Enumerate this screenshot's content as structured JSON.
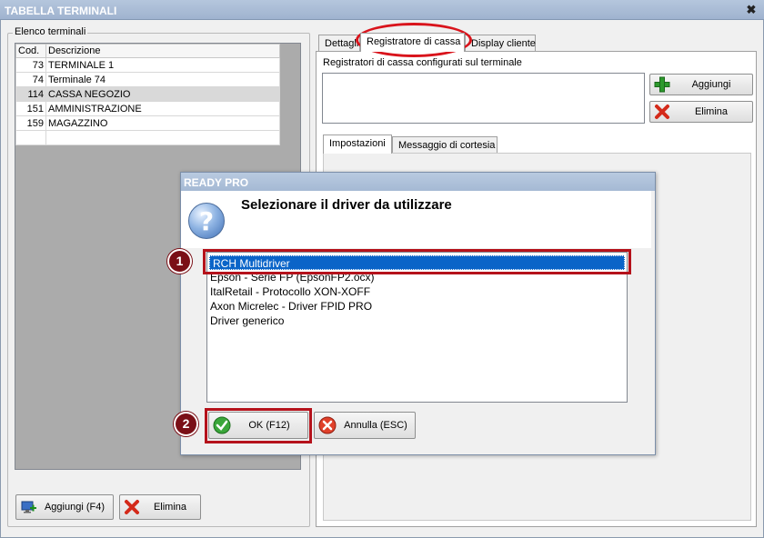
{
  "window": {
    "title": "TABELLA TERMINALI",
    "close_label": "✖"
  },
  "terminals_group": {
    "legend": "Elenco terminali",
    "columns": [
      "Cod.",
      "Descrizione"
    ],
    "rows": [
      {
        "code": "73",
        "description": "TERMINALE 1"
      },
      {
        "code": "74",
        "description": "Terminale 74"
      },
      {
        "code": "114",
        "description": "CASSA NEGOZIO"
      },
      {
        "code": "151",
        "description": "AMMINISTRAZIONE"
      },
      {
        "code": "159",
        "description": "MAGAZZINO"
      },
      {
        "code": "",
        "description": ""
      }
    ],
    "selected_row": 2,
    "add_label": "Aggiungi (F4)",
    "delete_label": "Elimina"
  },
  "right_panel": {
    "tabs": [
      "Dettagli",
      "Registratore di cassa",
      "Display cliente"
    ],
    "active_tab": 1,
    "registers_label": "Registratori di cassa configurati sul terminale",
    "add_label": "Aggiungi",
    "delete_label": "Elimina",
    "subtabs": [
      "Impostazioni",
      "Messaggio di cortesia"
    ],
    "active_subtab": 0
  },
  "dialog": {
    "title": "READY PRO",
    "question": "Selezionare il driver da utilizzare",
    "drivers": [
      "RCH Multidriver",
      "Epson - Serie FP (EpsonFP2.ocx)",
      "ItalRetail - Protocollo XON-XOFF",
      "Axon Micrelec - Driver FPID PRO",
      "Driver generico"
    ],
    "selected_driver": 0,
    "ok_label": "OK (F12)",
    "cancel_label": "Annulla (ESC)"
  },
  "annotations": {
    "badge_1": "1",
    "badge_2": "2"
  },
  "colors": {
    "highlight": "#b5121b",
    "badge": "#7a0f16",
    "selection": "#0a64c8",
    "title_bar": "#a5b9d4"
  }
}
